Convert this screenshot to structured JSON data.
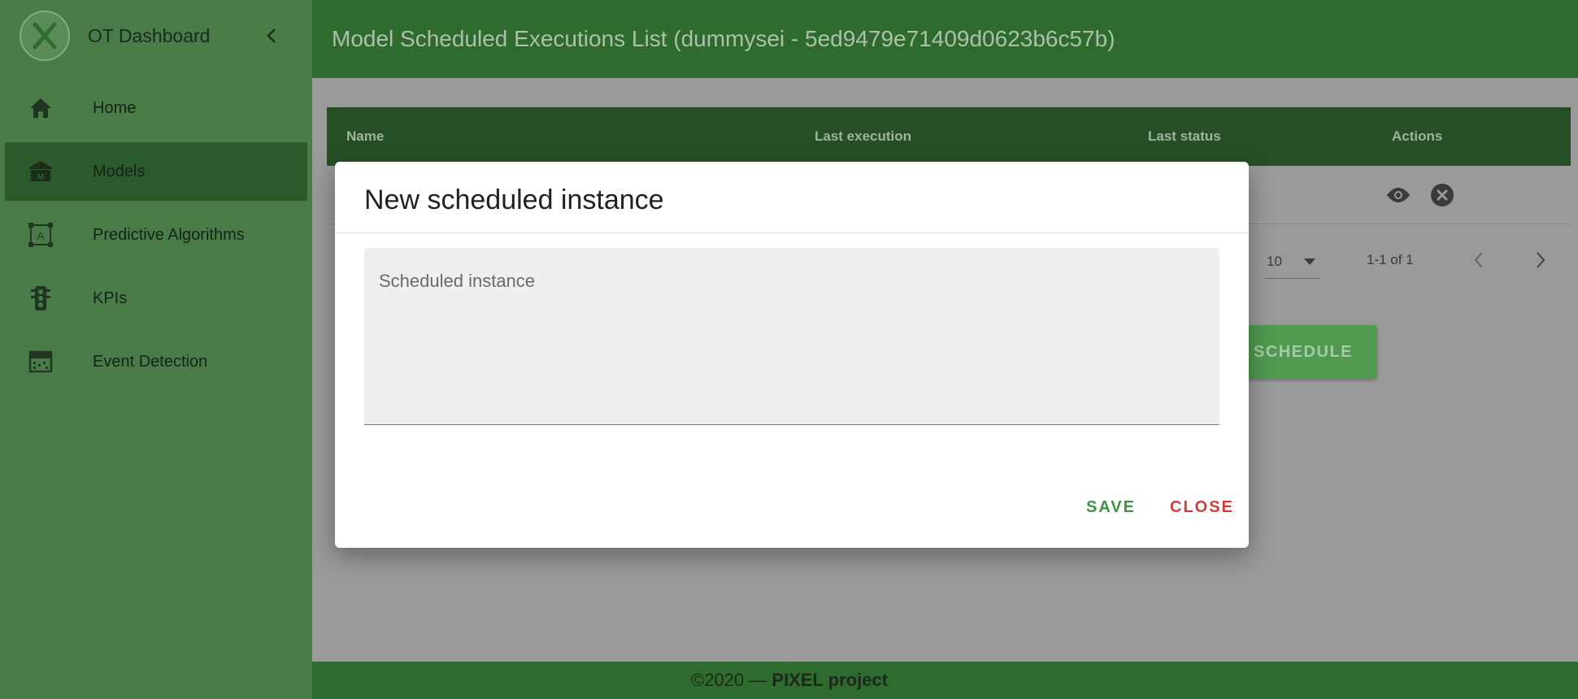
{
  "sidebar": {
    "title": "OT Dashboard",
    "items": [
      {
        "label": "Home",
        "icon": "home-icon"
      },
      {
        "label": "Models",
        "icon": "models-icon",
        "active": true
      },
      {
        "label": "Predictive Algorithms",
        "icon": "predictive-algorithms-icon"
      },
      {
        "label": "KPIs",
        "icon": "traffic-light-icon"
      },
      {
        "label": "Event Detection",
        "icon": "event-detection-icon"
      }
    ]
  },
  "header": {
    "title": "Model Scheduled Executions List (dummysei - 5ed9479e71409d0623b6c57b)"
  },
  "table": {
    "columns": [
      "Name",
      "Last execution",
      "Last status",
      "Actions"
    ],
    "pagination": {
      "rows_per_page": "10",
      "range": "1-1 of 1"
    }
  },
  "schedule_button": "SCHEDULE",
  "footer": {
    "copyright": "©2020 — ",
    "project": "PIXEL project"
  },
  "modal": {
    "title": "New scheduled instance",
    "textarea_placeholder": "Scheduled instance",
    "save_label": "SAVE",
    "close_label": "CLOSE"
  },
  "colors": {
    "sidebar_bg": "#4a7c4a",
    "header_bg": "#2f6a2f",
    "table_header_bg": "#264f26",
    "save": "#3f953f",
    "close": "#d33a3a"
  }
}
